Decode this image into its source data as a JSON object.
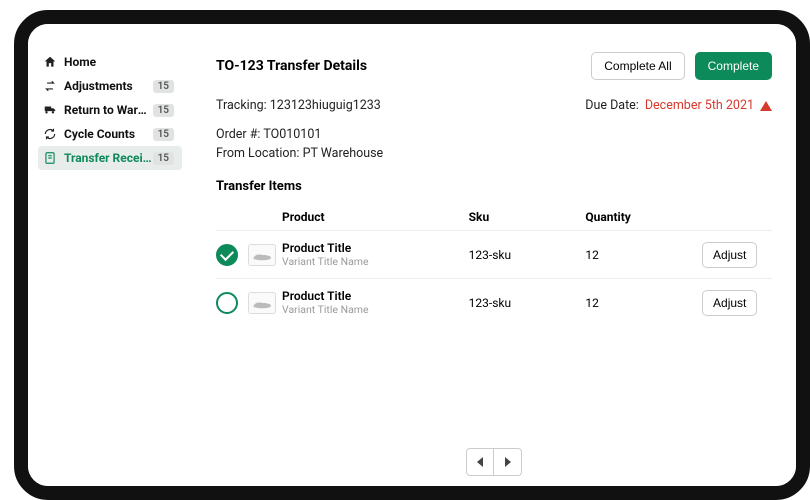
{
  "sidebar": {
    "items": [
      {
        "label": "Home",
        "badge": null,
        "icon": "home-icon",
        "active": false
      },
      {
        "label": "Adjustments",
        "badge": "15",
        "icon": "swap-icon",
        "active": false
      },
      {
        "label": "Return to Warehouse",
        "badge": "15",
        "icon": "truck-icon",
        "active": false
      },
      {
        "label": "Cycle Counts",
        "badge": "15",
        "icon": "refresh-icon",
        "active": false
      },
      {
        "label": "Transfer Receipts",
        "badge": "15",
        "icon": "receipt-icon",
        "active": true
      }
    ]
  },
  "header": {
    "title": "TO-123 Transfer Details",
    "complete_all_label": "Complete All",
    "complete_label": "Complete"
  },
  "details": {
    "tracking_label": "Tracking:",
    "tracking_value": "123123hiuguig1233",
    "due_date_label": "Due Date:",
    "due_date_value": "December 5th 2021",
    "order_label": "Order #:",
    "order_value": "TO010101",
    "from_label": "From Location:",
    "from_value": "PT Warehouse"
  },
  "items_section": {
    "title": "Transfer Items",
    "columns": {
      "product": "Product",
      "sku": "Sku",
      "quantity": "Quantity"
    },
    "adjust_label": "Adjust",
    "rows": [
      {
        "checked": true,
        "title": "Product Title",
        "variant": "Variant Title Name",
        "sku": "123-sku",
        "qty": "12"
      },
      {
        "checked": false,
        "title": "Product Title",
        "variant": "Variant Title Name",
        "sku": "123-sku",
        "qty": "12"
      }
    ]
  }
}
